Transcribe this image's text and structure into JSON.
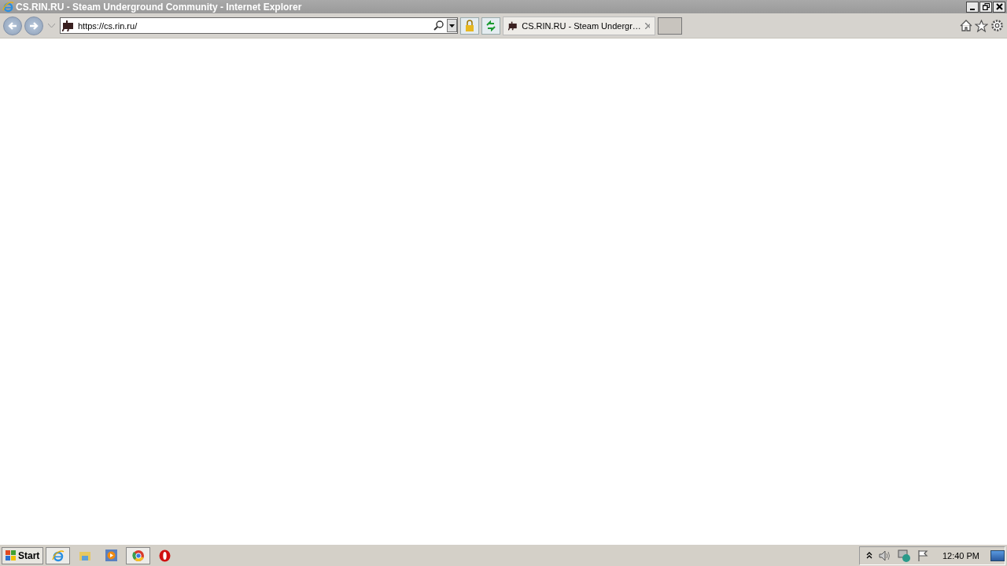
{
  "window": {
    "title": "CS.RIN.RU - Steam Underground Community - Internet Explorer"
  },
  "address_bar": {
    "value": "https://cs.rin.ru/"
  },
  "tabs": [
    {
      "label": "CS.RIN.RU - Steam Undergr…",
      "selected": true
    }
  ],
  "taskbar": {
    "start_label": "Start",
    "apps": [
      {
        "selected": true
      },
      {
        "selected": false
      },
      {
        "selected": false
      },
      {
        "selected": true
      },
      {
        "selected": false
      }
    ],
    "clock": "12:40 PM"
  }
}
